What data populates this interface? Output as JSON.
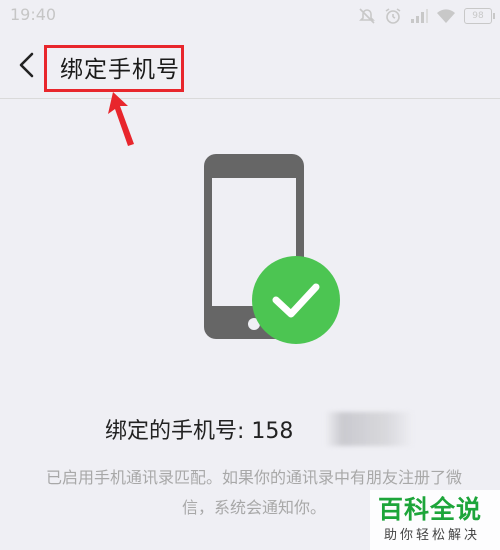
{
  "status_bar": {
    "time": "19:40",
    "battery": "98"
  },
  "header": {
    "title": "绑定手机号"
  },
  "main": {
    "bound_label": "绑定的手机号: 158",
    "description": "已启用手机通讯录匹配。如果你的通讯录中有朋友注册了微信，系统会通知你。"
  },
  "watermark": {
    "main": "百科全说",
    "sub": "助你轻松解决"
  },
  "colors": {
    "success_green": "#4cc552",
    "phone_gray": "#666666",
    "annotation_red": "#e8262c",
    "watermark_green": "#1da53a"
  }
}
